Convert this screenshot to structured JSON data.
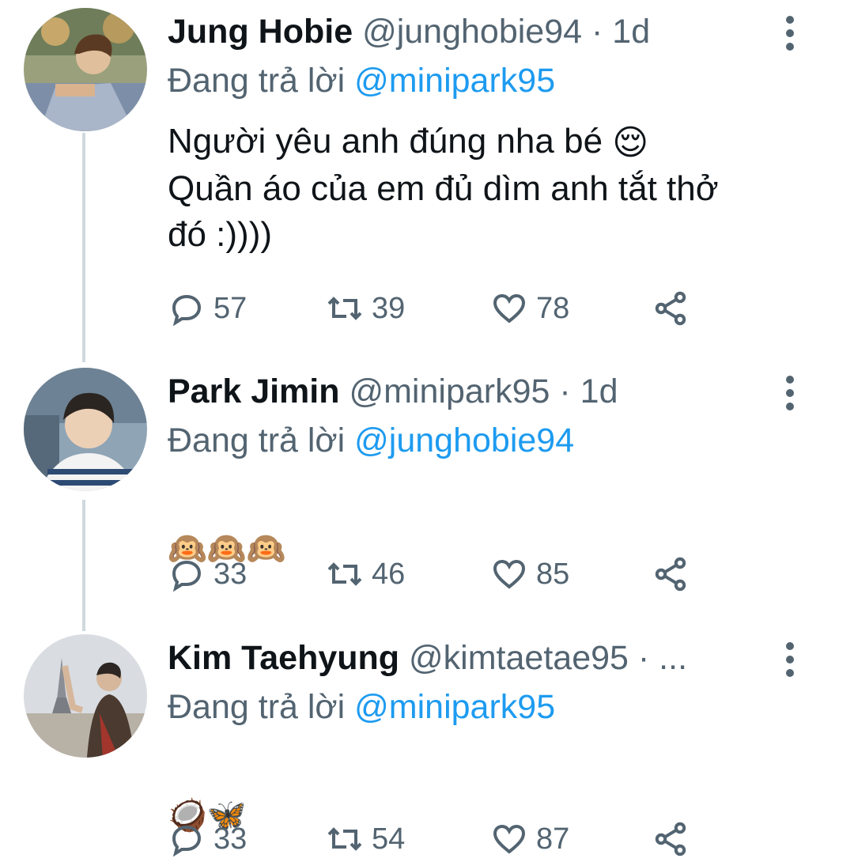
{
  "tweets": [
    {
      "name": "Jung Hobie",
      "handle": "@junghobie94",
      "sep": "·",
      "time": "1d",
      "reply_prefix": "Đang trả lời",
      "reply_to": "@minipark95",
      "text_line1": "Người yêu anh đúng nha bé",
      "text_emoji": "😌",
      "text_rest": "Quần áo của em đủ dìm anh tắt thở\nđó :))))",
      "replies": "57",
      "retweets": "39",
      "likes": "78"
    },
    {
      "name": "Park Jimin",
      "handle": "@minipark95",
      "sep": "·",
      "time": "1d",
      "reply_prefix": "Đang trả lời",
      "reply_to": "@junghobie94",
      "emojis": [
        "🙉",
        "🙉",
        "🙉"
      ],
      "replies": "33",
      "retweets": "46",
      "likes": "85"
    },
    {
      "name": "Kim Taehyung",
      "handle": "@kimtaetae95",
      "sep": "·",
      "time": "...",
      "reply_prefix": "Đang trả lời",
      "reply_to": "@minipark95",
      "emojis": [
        "🥥",
        "🦋"
      ],
      "replies": "33",
      "retweets": "54",
      "likes": "87"
    }
  ],
  "icons": {
    "reply": "reply-icon",
    "retweet": "retweet-icon",
    "like": "heart-icon",
    "share": "share-icon",
    "more": "more-vertical-icon"
  },
  "colors": {
    "text": "#0f1419",
    "secondary": "#536471",
    "link": "#1d9bf0",
    "thread_line": "#cfd9de"
  }
}
